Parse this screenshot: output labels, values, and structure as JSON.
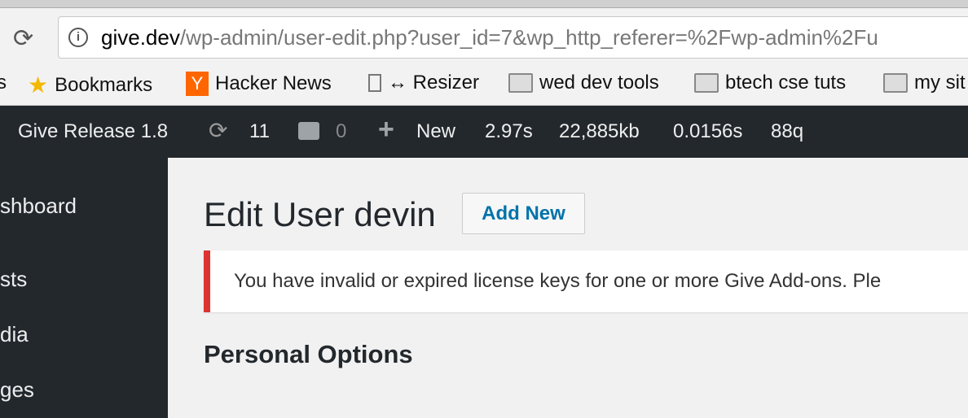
{
  "browser": {
    "url_host": "give.dev",
    "url_path": "/wp-admin/user-edit.php?user_id=7&wp_http_referer=%2Fwp-admin%2Fu",
    "bookmarks": [
      {
        "label": "s",
        "icon": "none"
      },
      {
        "label": "Bookmarks",
        "icon": "star-icon"
      },
      {
        "label": "Hacker News",
        "icon": "y-logo",
        "logo": "Y"
      },
      {
        "label": "↔ Resizer",
        "icon": "page-icon"
      },
      {
        "label": "wed dev tools",
        "icon": "folder-icon"
      },
      {
        "label": "btech cse tuts",
        "icon": "folder-icon"
      },
      {
        "label": "my sit",
        "icon": "folder-icon"
      }
    ]
  },
  "adminbar": {
    "site": "Give Release 1.8",
    "updates": "11",
    "comments": "0",
    "new": "New",
    "stats": [
      "2.97s",
      "22,885kb",
      "0.0156s",
      "88q"
    ]
  },
  "sidebar": {
    "items": [
      "shboard",
      "sts",
      "dia",
      "ges"
    ]
  },
  "main": {
    "title": "Edit User devin",
    "add_new": "Add New",
    "notice": "You have invalid or expired license keys for one or more Give Add-ons. Ple",
    "section": "Personal Options"
  },
  "colors": {
    "adminbar": "#23282d",
    "notice_border": "#dc3232",
    "link": "#0073aa"
  }
}
